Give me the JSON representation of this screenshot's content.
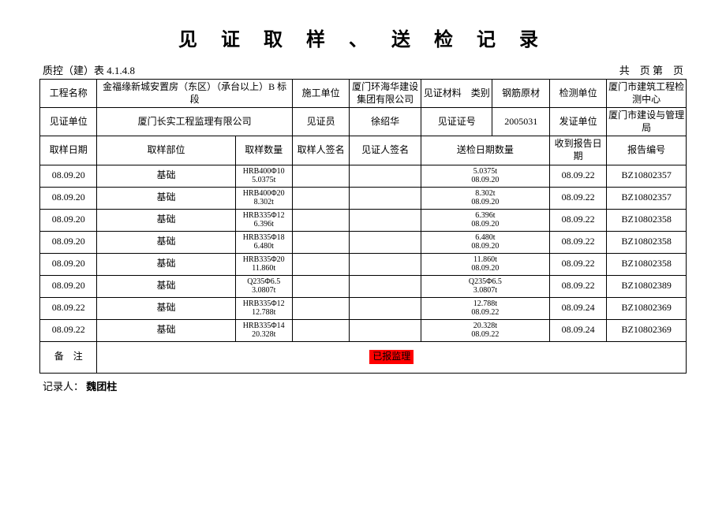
{
  "title": "见 证 取 样 、 送 检 记 录",
  "form_no": "质控（建）表 4.1.4.8",
  "page_info": "共　页 第　页",
  "header1": {
    "c0_label": "工程名称",
    "c0_value": "金福缘新城安置房（东区）（承台以上）B 标段",
    "c1_label": "施工单位",
    "c1_value": "厦门环海华建设集团有限公司",
    "c2_label": "见证材料　类别",
    "c2_value": "钢筋原材",
    "c3_label": "检测单位",
    "c3_value": "厦门市建筑工程检测中心"
  },
  "header2": {
    "c0_label": "见证单位",
    "c0_value": "厦门长实工程监理有限公司",
    "c1_label": "见证员",
    "c1_value": "徐绍华",
    "c2_label": "见证证号",
    "c2_value": "2005031",
    "c3_label": "发证单位",
    "c3_value": "厦门市建设与管理局"
  },
  "cols": {
    "c0": "取样日期",
    "c1": "取样部位",
    "c2": "取样数量",
    "c3": "取样人签名",
    "c4": "见证人签名",
    "c5": "送检日期数量",
    "c6": "收到报告日期",
    "c7": "报告编号"
  },
  "rows": [
    {
      "date": "08.09.20",
      "part": "基础",
      "qty1": "HRB400Φ10",
      "qty2": "5.0375t",
      "sub1": "5.0375t",
      "sub2": "08.09.20",
      "recv": "08.09.22",
      "rep": "BZ10802357"
    },
    {
      "date": "08.09.20",
      "part": "基础",
      "qty1": "HRB400Φ20",
      "qty2": "8.302t",
      "sub1": "8.302t",
      "sub2": "08.09.20",
      "recv": "08.09.22",
      "rep": "BZ10802357"
    },
    {
      "date": "08.09.20",
      "part": "基础",
      "qty1": "HRB335Φ12",
      "qty2": "6.396t",
      "sub1": "6.396t",
      "sub2": "08.09.20",
      "recv": "08.09.22",
      "rep": "BZ10802358"
    },
    {
      "date": "08.09.20",
      "part": "基础",
      "qty1": "HRB335Φ18",
      "qty2": "6.480t",
      "sub1": "6.480t",
      "sub2": "08.09.20",
      "recv": "08.09.22",
      "rep": "BZ10802358"
    },
    {
      "date": "08.09.20",
      "part": "基础",
      "qty1": "HRB335Φ20",
      "qty2": "11.860t",
      "sub1": "11.860t",
      "sub2": "08.09.20",
      "recv": "08.09.22",
      "rep": "BZ10802358"
    },
    {
      "date": "08.09.20",
      "part": "基础",
      "qty1": "Q235Φ6.5",
      "qty2": "3.0807t",
      "sub1": "Q235Φ6.5",
      "sub2": "3.0807t",
      "recv": "08.09.22",
      "rep": "BZ10802389"
    },
    {
      "date": "08.09.22",
      "part": "基础",
      "qty1": "HRB335Φ12",
      "qty2": "12.788t",
      "sub1": "12.788t",
      "sub2": "08.09.22",
      "recv": "08.09.24",
      "rep": "BZ10802369"
    },
    {
      "date": "08.09.22",
      "part": "基础",
      "qty1": "HRB335Φ14",
      "qty2": "20.328t",
      "sub1": "20.328t",
      "sub2": "08.09.22",
      "recv": "08.09.24",
      "rep": "BZ10802369"
    }
  ],
  "remark_label": "备　注",
  "remark_value": "已报监理",
  "recorder_label": "记录人：",
  "recorder_name": "魏团柱"
}
